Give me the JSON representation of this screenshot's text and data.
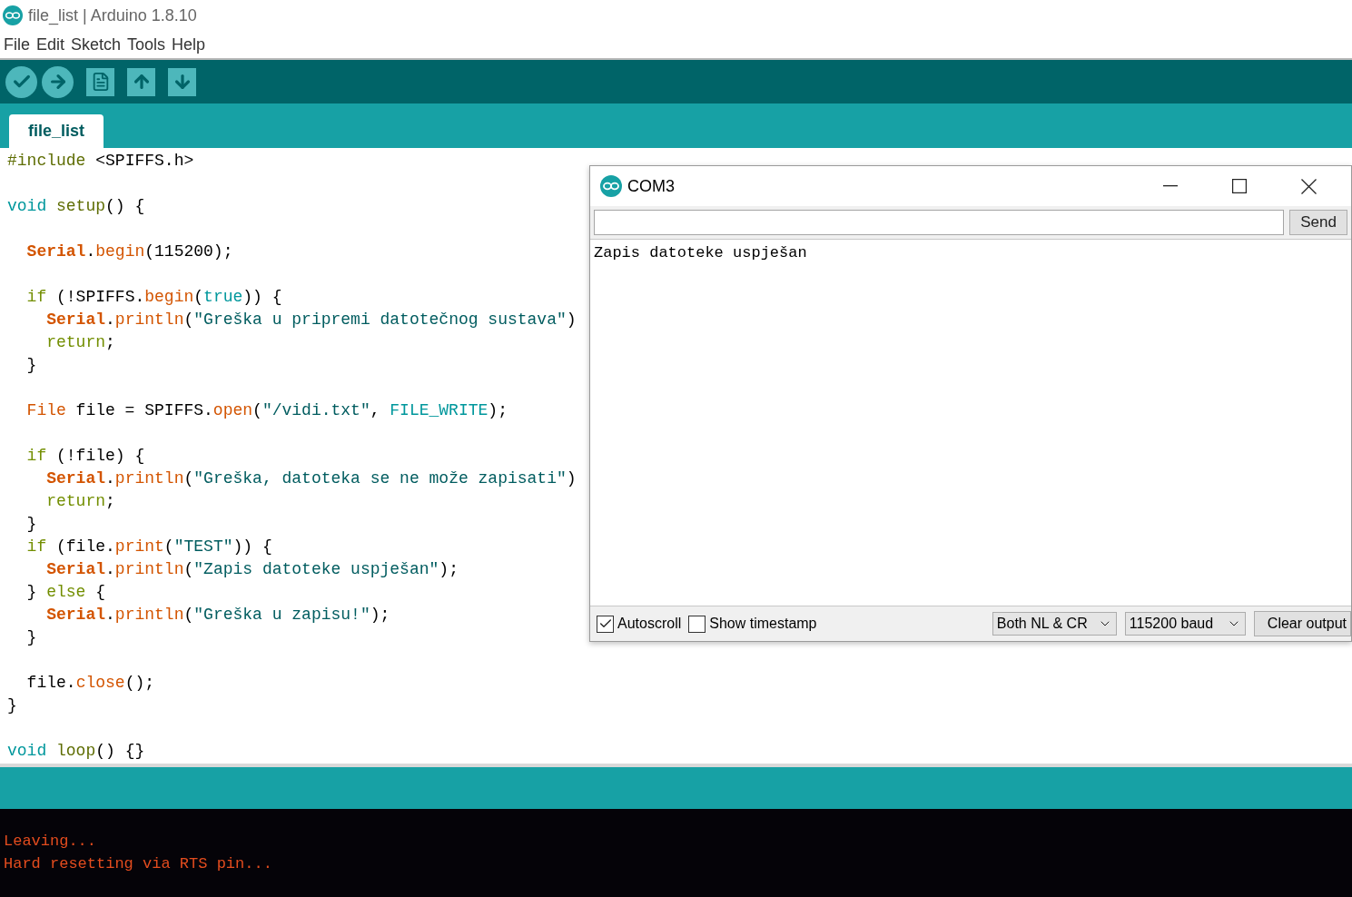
{
  "window": {
    "title": "file_list | Arduino 1.8.10"
  },
  "menu": [
    "File",
    "Edit",
    "Sketch",
    "Tools",
    "Help"
  ],
  "tabs": [
    {
      "label": "file_list",
      "selected": true
    }
  ],
  "editor": {
    "lines": [
      {
        "kind": "code",
        "tokens": [
          {
            "text": "#include",
            "kind": "pre"
          },
          {
            "text": " <SPIFFS.h>",
            "kind": "p"
          }
        ]
      },
      {
        "kind": "blank"
      },
      {
        "kind": "code",
        "tokens": [
          {
            "text": "void ",
            "kind": "type"
          },
          {
            "text": "setup",
            "kind": "func"
          },
          {
            "text": "() {",
            "kind": "p"
          }
        ]
      },
      {
        "kind": "blank"
      },
      {
        "kind": "code",
        "tokens": [
          {
            "text": "  Serial",
            "kind": "cls"
          },
          {
            "text": ".",
            "kind": "p"
          },
          {
            "text": "begin",
            "kind": "m"
          },
          {
            "text": "(115200);",
            "kind": "p"
          }
        ]
      },
      {
        "kind": "blank"
      },
      {
        "kind": "code",
        "tokens": [
          {
            "text": "  if",
            "kind": "kw"
          },
          {
            "text": " (!SPIFFS.",
            "kind": "p"
          },
          {
            "text": "begin",
            "kind": "m"
          },
          {
            "text": "(",
            "kind": "p"
          },
          {
            "text": "true",
            "kind": "const"
          },
          {
            "text": ")) {",
            "kind": "p"
          }
        ]
      },
      {
        "kind": "code",
        "tokens": [
          {
            "text": "    Serial",
            "kind": "cls"
          },
          {
            "text": ".",
            "kind": "p"
          },
          {
            "text": "println",
            "kind": "m"
          },
          {
            "text": "(",
            "kind": "p"
          },
          {
            "text": "\"Greška u pripremi datotečnog sustava\"",
            "kind": "s"
          },
          {
            "text": ")",
            "kind": "p"
          }
        ]
      },
      {
        "kind": "code",
        "tokens": [
          {
            "text": "    return",
            "kind": "kw"
          },
          {
            "text": ";",
            "kind": "p"
          }
        ]
      },
      {
        "kind": "code",
        "tokens": [
          {
            "text": "  }",
            "kind": "p"
          }
        ]
      },
      {
        "kind": "blank"
      },
      {
        "kind": "code",
        "tokens": [
          {
            "text": "  File",
            "kind": "m"
          },
          {
            "text": " file = SPIFFS.",
            "kind": "p"
          },
          {
            "text": "open",
            "kind": "m"
          },
          {
            "text": "(",
            "kind": "p"
          },
          {
            "text": "\"/vidi.txt\"",
            "kind": "s"
          },
          {
            "text": ", ",
            "kind": "p"
          },
          {
            "text": "FILE_WRITE",
            "kind": "const"
          },
          {
            "text": ");",
            "kind": "p"
          }
        ]
      },
      {
        "kind": "blank"
      },
      {
        "kind": "code",
        "tokens": [
          {
            "text": "  if",
            "kind": "kw"
          },
          {
            "text": " (!file) {",
            "kind": "p"
          }
        ]
      },
      {
        "kind": "code",
        "tokens": [
          {
            "text": "    Serial",
            "kind": "cls"
          },
          {
            "text": ".",
            "kind": "p"
          },
          {
            "text": "println",
            "kind": "m"
          },
          {
            "text": "(",
            "kind": "p"
          },
          {
            "text": "\"Greška, datoteka se ne može zapisati\"",
            "kind": "s"
          },
          {
            "text": ")",
            "kind": "p"
          }
        ]
      },
      {
        "kind": "code",
        "tokens": [
          {
            "text": "    return",
            "kind": "kw"
          },
          {
            "text": ";",
            "kind": "p"
          }
        ]
      },
      {
        "kind": "code",
        "tokens": [
          {
            "text": "  }",
            "kind": "p"
          }
        ]
      },
      {
        "kind": "code",
        "tokens": [
          {
            "text": "  if",
            "kind": "kw"
          },
          {
            "text": " (file.",
            "kind": "p"
          },
          {
            "text": "print",
            "kind": "m"
          },
          {
            "text": "(",
            "kind": "p"
          },
          {
            "text": "\"TEST\"",
            "kind": "s"
          },
          {
            "text": ")) {",
            "kind": "p"
          }
        ]
      },
      {
        "kind": "code",
        "tokens": [
          {
            "text": "    Serial",
            "kind": "cls"
          },
          {
            "text": ".",
            "kind": "p"
          },
          {
            "text": "println",
            "kind": "m"
          },
          {
            "text": "(",
            "kind": "p"
          },
          {
            "text": "\"Zapis datoteke uspješan\"",
            "kind": "s"
          },
          {
            "text": ");",
            "kind": "p"
          }
        ]
      },
      {
        "kind": "code",
        "tokens": [
          {
            "text": "  } ",
            "kind": "p"
          },
          {
            "text": "else",
            "kind": "kw"
          },
          {
            "text": " {",
            "kind": "p"
          }
        ]
      },
      {
        "kind": "code",
        "tokens": [
          {
            "text": "    Serial",
            "kind": "cls"
          },
          {
            "text": ".",
            "kind": "p"
          },
          {
            "text": "println",
            "kind": "m"
          },
          {
            "text": "(",
            "kind": "p"
          },
          {
            "text": "\"Greška u zapisu!\"",
            "kind": "s"
          },
          {
            "text": ");",
            "kind": "p"
          }
        ]
      },
      {
        "kind": "code",
        "tokens": [
          {
            "text": "  }",
            "kind": "p"
          }
        ]
      },
      {
        "kind": "blank"
      },
      {
        "kind": "code",
        "tokens": [
          {
            "text": "  file.",
            "kind": "p"
          },
          {
            "text": "close",
            "kind": "m"
          },
          {
            "text": "();",
            "kind": "p"
          }
        ]
      },
      {
        "kind": "code",
        "tokens": [
          {
            "text": "}",
            "kind": "p"
          }
        ]
      },
      {
        "kind": "blank"
      },
      {
        "kind": "code",
        "tokens": [
          {
            "text": "void ",
            "kind": "type"
          },
          {
            "text": "loop",
            "kind": "func"
          },
          {
            "text": "() {}",
            "kind": "p"
          }
        ]
      }
    ]
  },
  "console": {
    "lines": [
      "Leaving...",
      "Hard resetting via RTS pin..."
    ]
  },
  "serial_monitor": {
    "title": "COM3",
    "send_button": "Send",
    "output": [
      "Zapis datoteke uspješan"
    ],
    "autoscroll": {
      "label": "Autoscroll",
      "checked": true
    },
    "timestamp": {
      "label": "Show timestamp",
      "checked": false
    },
    "line_ending": "Both NL & CR",
    "baud_rate": "115200 baud",
    "clear_button": "Clear output"
  }
}
